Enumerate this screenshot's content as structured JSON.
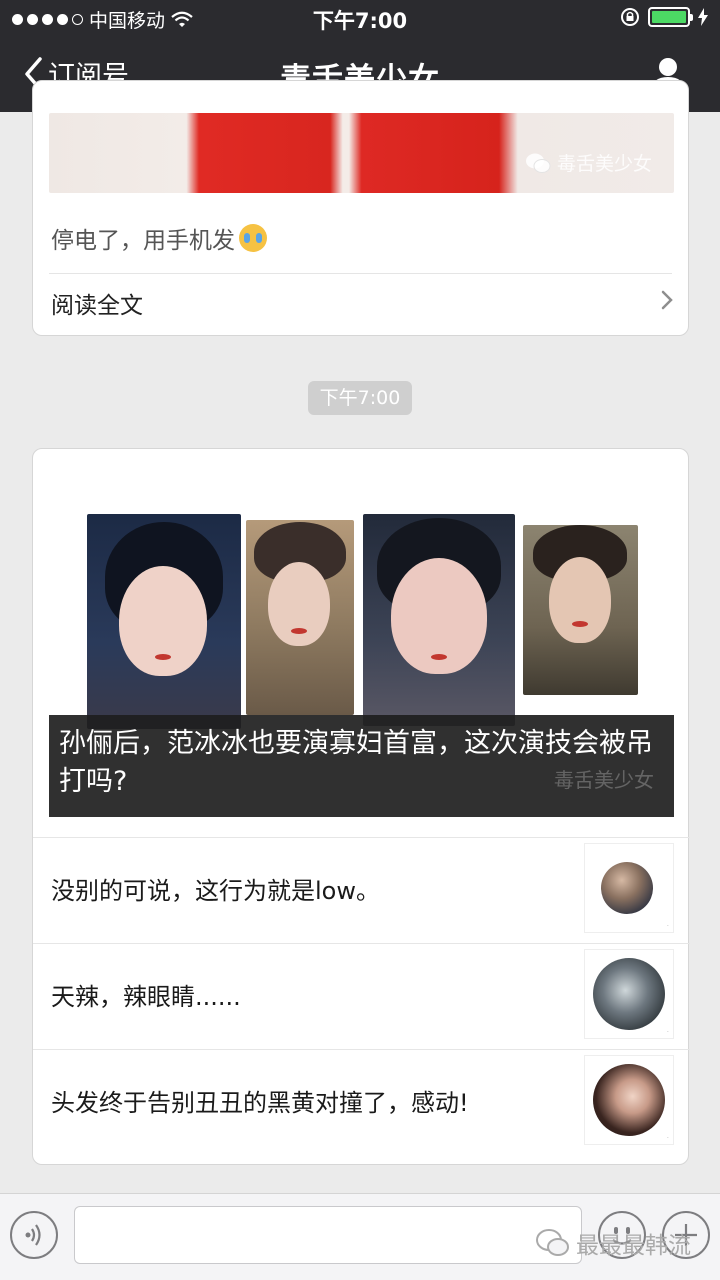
{
  "status_bar": {
    "carrier": "中国移动",
    "time": "下午7:00"
  },
  "nav": {
    "back_label": "订阅号",
    "title": "毒舌美少女"
  },
  "article_1": {
    "watermark": "毒舌美少女",
    "caption": "停电了，用手机发",
    "read_all": "阅读全文"
  },
  "time_divider": "下午7:00",
  "article_2": {
    "headline": "孙俪后，范冰冰也要演寡妇首富，这次演技会被吊打吗?",
    "watermark": "毒舌美少女",
    "items": [
      {
        "title": "没别的可说，这行为就是low。"
      },
      {
        "title": "天辣，辣眼睛......"
      },
      {
        "title": "头发终于告别丑丑的黑黄对撞了，感动!"
      }
    ]
  },
  "input_bar": {
    "watermark": "最最最韩流"
  }
}
